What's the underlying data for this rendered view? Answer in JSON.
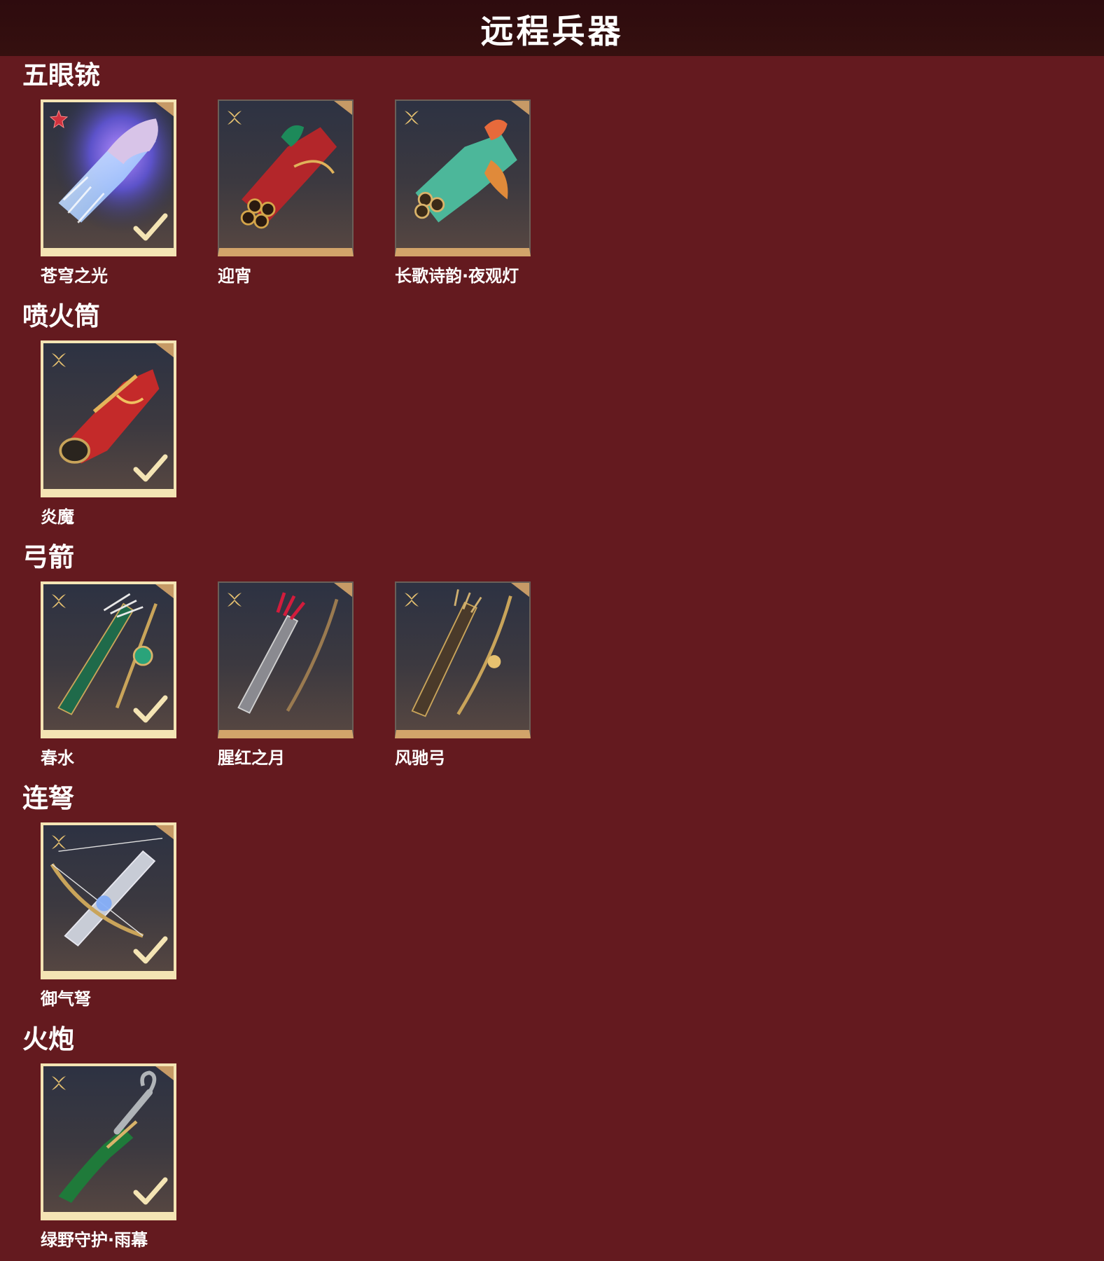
{
  "header": {
    "title": "远程兵器"
  },
  "sections": [
    {
      "title": "五眼铳",
      "items": [
        {
          "label": "苍穹之光",
          "selected": true,
          "rarity_icon": "red-star-icon"
        },
        {
          "label": "迎宵",
          "selected": false,
          "rarity_icon": "gold-flower-icon"
        },
        {
          "label": "长歌诗韵·夜观灯",
          "selected": false,
          "rarity_icon": "gold-flower-icon"
        }
      ]
    },
    {
      "title": "喷火筒",
      "items": [
        {
          "label": "炎魔",
          "selected": true,
          "rarity_icon": "gold-flower-icon"
        }
      ]
    },
    {
      "title": "弓箭",
      "items": [
        {
          "label": "春水",
          "selected": true,
          "rarity_icon": "gold-flower-icon"
        },
        {
          "label": "腥红之月",
          "selected": false,
          "rarity_icon": "gold-flower-icon"
        },
        {
          "label": "风驰弓",
          "selected": false,
          "rarity_icon": "gold-flower-icon"
        }
      ]
    },
    {
      "title": "连弩",
      "items": [
        {
          "label": "御气弩",
          "selected": true,
          "rarity_icon": "gold-flower-icon"
        }
      ]
    },
    {
      "title": "火炮",
      "items": [
        {
          "label": "绿野守护·雨幕",
          "selected": true,
          "rarity_icon": "gold-flower-icon"
        }
      ]
    }
  ]
}
